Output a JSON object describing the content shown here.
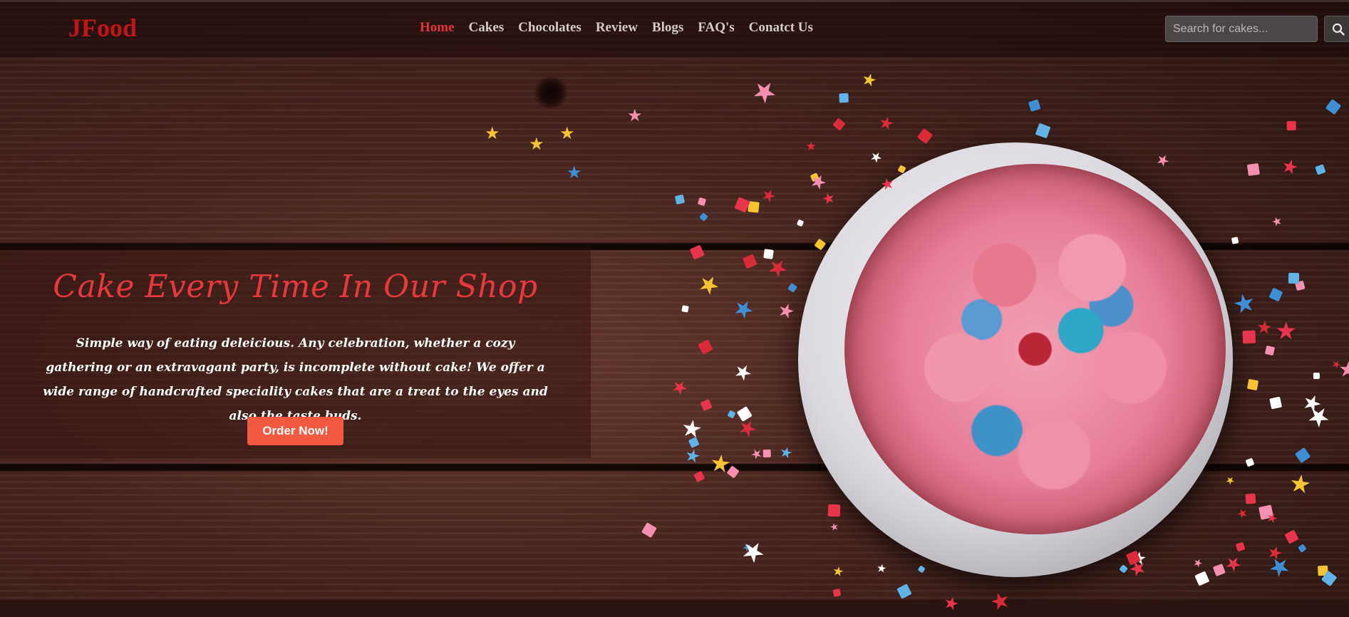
{
  "header": {
    "logo": "JFood",
    "nav": [
      {
        "label": "Home",
        "active": true
      },
      {
        "label": "Cakes",
        "active": false
      },
      {
        "label": "Chocolates",
        "active": false
      },
      {
        "label": "Review",
        "active": false
      },
      {
        "label": "Blogs",
        "active": false
      },
      {
        "label": "FAQ's",
        "active": false
      },
      {
        "label": "Conatct Us",
        "active": false
      }
    ],
    "search": {
      "placeholder": "Search for cakes...",
      "value": "",
      "icon": "search-icon"
    }
  },
  "hero": {
    "title": "Cake Every Time In Our Shop",
    "description": "Simple way of eating deleicious. Any celebration, whether a cozy gathering or an extravagant party, is incomplete without cake! We offer a wide range of handcrafted speciality cakes that are a treat to the eyes and also the taste buds.",
    "cta_label": "Order Now!"
  },
  "colors": {
    "brand": "#c0161b",
    "nav_active": "#e2353a",
    "title": "#e8383e",
    "cta": "#f15a40"
  }
}
